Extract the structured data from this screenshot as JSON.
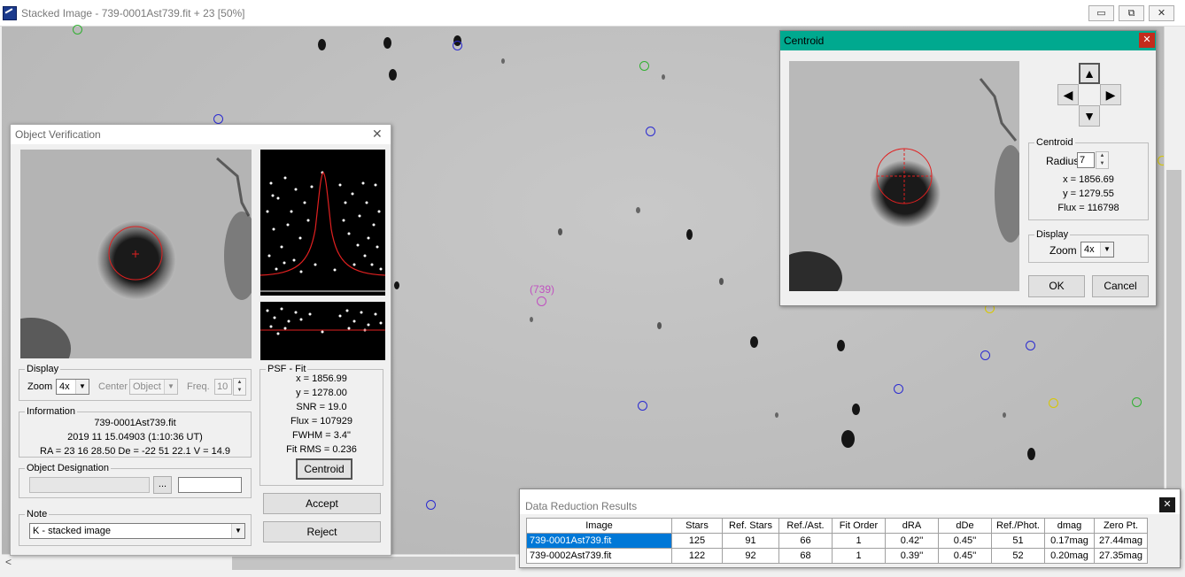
{
  "main_window": {
    "title": "Stacked Image - 739-0001Ast739.fit + 23 [50%]",
    "buttons": {
      "minimize": "▭",
      "restore": "⧉",
      "close": "✕"
    },
    "hscroll_left": "<"
  },
  "sky": {
    "target_label": "(739)",
    "colors": {
      "background": "#bdbdbd",
      "target": "#c050c0",
      "ref_blue": "#2a2ad0",
      "ref_green": "#30b030",
      "ref_yellow": "#d8c800"
    }
  },
  "object_verification": {
    "title": "Object Verification",
    "close": "✕",
    "display": {
      "legend": "Display",
      "zoom_label": "Zoom",
      "zoom_value": "4x",
      "center_label": "Center",
      "center_value": "Object",
      "freq_label": "Freq.",
      "freq_value": "10"
    },
    "information": {
      "legend": "Information",
      "file": "739-0001Ast739.fit",
      "time": "2019 11 15.04903 (1:10:36 UT)",
      "coords": "RA = 23 16 28.50   De = -22 51 22.1   V = 14.9"
    },
    "designation": {
      "legend": "Object Designation",
      "browse": "..."
    },
    "note": {
      "legend": "Note",
      "value": "K - stacked image"
    },
    "psf": {
      "legend": "PSF - Fit",
      "x": "x = 1856.99",
      "y": "y = 1278.00",
      "snr": "SNR = 19.0",
      "flux": "Flux = 107929",
      "fwhm": "FWHM = 3.4\"",
      "fit_rms": "Fit RMS = 0.236",
      "centroid_button": "Centroid"
    },
    "accept": "Accept",
    "reject": "Reject"
  },
  "centroid": {
    "title": "Centroid",
    "close": "✕",
    "arrows": {
      "up": "▲",
      "left": "◀",
      "right": "▶",
      "down": "▼"
    },
    "group": {
      "legend": "Centroid",
      "radius_label": "Radius",
      "radius_value": "7",
      "x": "x = 1856.69",
      "y": "y = 1279.55",
      "flux": "Flux = 116798"
    },
    "display": {
      "legend": "Display",
      "zoom_label": "Zoom",
      "zoom_value": "4x"
    },
    "ok": "OK",
    "cancel": "Cancel"
  },
  "data_reduction": {
    "title": "Data Reduction Results",
    "close": "✕",
    "columns": [
      "Image",
      "Stars",
      "Ref. Stars",
      "Ref./Ast.",
      "Fit Order",
      "dRA",
      "dDe",
      "Ref./Phot.",
      "dmag",
      "Zero Pt."
    ],
    "rows": [
      [
        "739-0001Ast739.fit",
        "125",
        "91",
        "66",
        "1",
        "0.42''",
        "0.45''",
        "51",
        "0.17mag",
        "27.44mag"
      ],
      [
        "739-0002Ast739.fit",
        "122",
        "92",
        "68",
        "1",
        "0.39''",
        "0.45''",
        "52",
        "0.20mag",
        "27.35mag"
      ]
    ],
    "selected_row": 0
  }
}
